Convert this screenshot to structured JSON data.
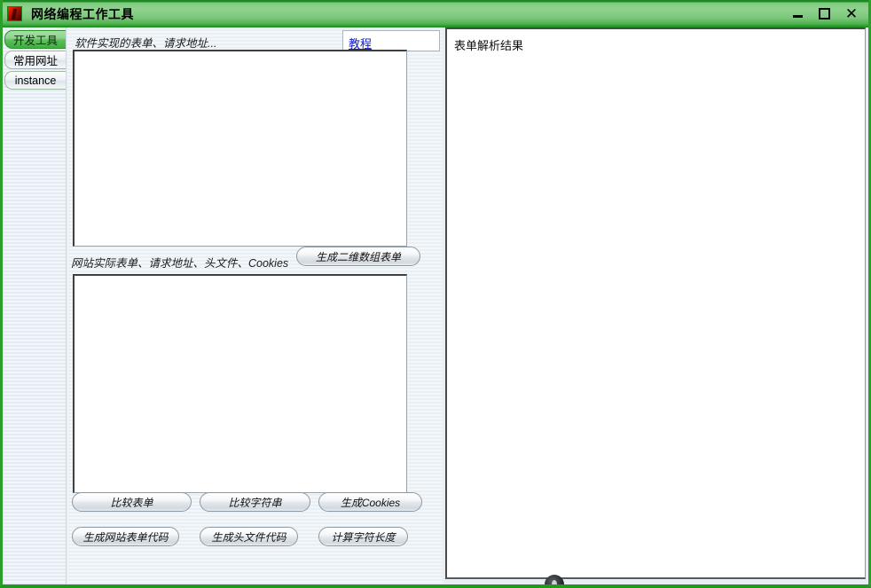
{
  "window": {
    "title": "网络编程工作工具",
    "icon": "app-icon",
    "controls": {
      "minimize": "minimize-icon",
      "maximize": "maximize-icon",
      "close": "✕"
    }
  },
  "sidebar": {
    "tabs": [
      {
        "label": "开发工具",
        "selected": true
      },
      {
        "label": "常用网址",
        "selected": false
      },
      {
        "label": "instance",
        "selected": false
      }
    ]
  },
  "left_panel": {
    "caption_top": "软件实现的表单、请求地址...",
    "tutorial_link": "教程",
    "caption_middle": "网站实际表单、请求地址、头文件、Cookies",
    "textarea_top_value": "",
    "textarea_top_placeholder": "",
    "textarea_bottom_value": "",
    "textarea_bottom_placeholder": "",
    "buttons": {
      "generate_2d_array_form": "生成二维数组表单",
      "compare_form": "比较表单",
      "compare_string": "比较字符串",
      "generate_cookies": "生成Cookies",
      "generate_site_form_code": "生成网站表单代码",
      "generate_header_code": "生成头文件代码",
      "calc_string_length": "计算字符长度"
    }
  },
  "right_panel": {
    "label": "表单解析结果",
    "content": ""
  },
  "colors": {
    "titlebar_green": "#7fc97f",
    "accent_green": "#2aa02a",
    "link_blue": "#1020c8",
    "tab_selected_green": "#5cbe5c"
  }
}
